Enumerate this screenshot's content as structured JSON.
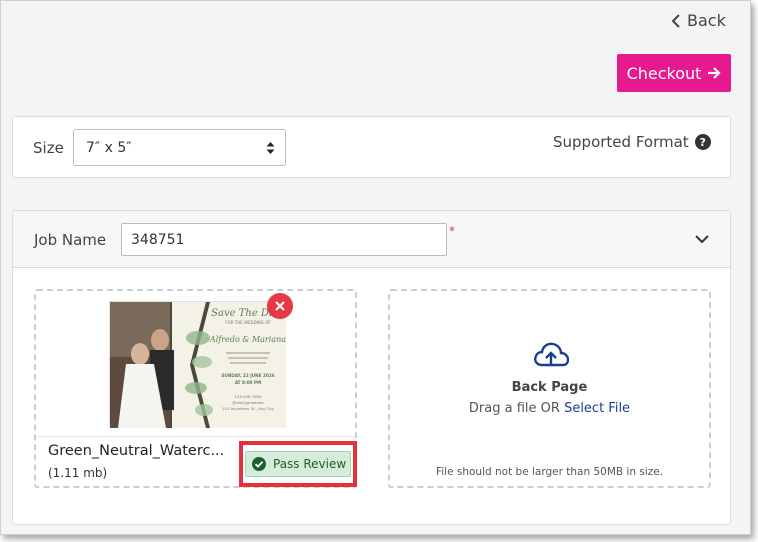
{
  "nav": {
    "back_label": "Back"
  },
  "checkout": {
    "label": "Checkout"
  },
  "size": {
    "label": "Size",
    "selected": "7″ x 5″"
  },
  "supported_format": {
    "label": "Supported Format",
    "help_glyph": "?"
  },
  "job": {
    "label": "Job Name",
    "value": "348751",
    "required_mark": "*"
  },
  "front": {
    "file_name": "Green_Neutral_Waterc...",
    "file_size": "(1.11 mb)",
    "status": "Pass Review",
    "preview": {
      "title": "Save The Date",
      "subtitle": "FOR THE WEDDING OF",
      "names": "Alfredo & Mariana",
      "date_line": "SUNDAY, 22 JUNE 2026",
      "time_line": "AT 8:00 PM",
      "contact": "123-456-7890",
      "handle": "@reallygreatsite",
      "address": "123 Anywhere St., Any City"
    }
  },
  "back": {
    "title": "Back Page",
    "drag_text": "Drag a file OR",
    "select_link": "Select File",
    "limit_text": "File should not be larger than 50MB in size."
  },
  "colors": {
    "accent": "#e6198f",
    "remove": "#e53945",
    "pass_bg": "#d4ecd9",
    "pass_text": "#1e5f2e",
    "highlight": "#e0323a",
    "link": "#1a3f8f"
  },
  "icons": {
    "back": "chevron-left-icon",
    "checkout": "arrow-right-icon",
    "select": "up-down-arrows-icon",
    "help": "question-circle-icon",
    "collapse": "chevron-down-icon",
    "remove": "close-icon",
    "status": "check-circle-icon",
    "upload": "cloud-upload-icon"
  }
}
